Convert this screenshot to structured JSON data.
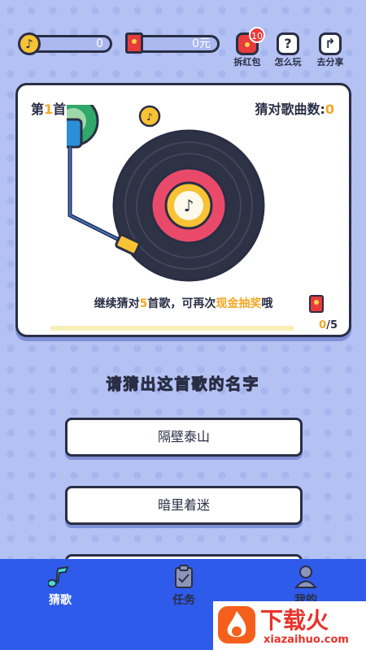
{
  "header": {
    "coins": "0",
    "cash": "0元",
    "red_packet_badge": "10",
    "buttons": [
      {
        "label": "拆红包",
        "icon": "red-packet-icon"
      },
      {
        "label": "怎么玩",
        "icon": "question-icon"
      },
      {
        "label": "去分享",
        "icon": "share-icon"
      }
    ]
  },
  "card": {
    "song_prefix": "第",
    "song_number": "1",
    "song_suffix": "首",
    "guessed_label": "猜对歌曲数:",
    "guessed_count": "0",
    "hint_prefix": "继续猜对",
    "hint_count": "5",
    "hint_mid": "首歌，可再次",
    "hint_highlight": "现金抽奖",
    "hint_suffix": "哦",
    "progress_current": "0",
    "progress_total": "/5",
    "progress_fraction": 0.0
  },
  "question": {
    "prompt": "请猜出这首歌的名字",
    "options": [
      "隔壁泰山",
      "暗里着迷"
    ]
  },
  "nav": {
    "items": [
      {
        "label": "猜歌",
        "icon": "music-note-icon",
        "active": true
      },
      {
        "label": "任务",
        "icon": "clipboard-icon",
        "active": false
      },
      {
        "label": "我的",
        "icon": "user-icon",
        "active": false
      }
    ]
  },
  "watermark": {
    "title": "下载火",
    "url": "xiazaihuo.com"
  },
  "colors": {
    "background": "#b4c2f3",
    "accent": "#f5a623",
    "nav": "#2f5bea",
    "outline": "#2a2e45",
    "red": "#e83b3b"
  }
}
